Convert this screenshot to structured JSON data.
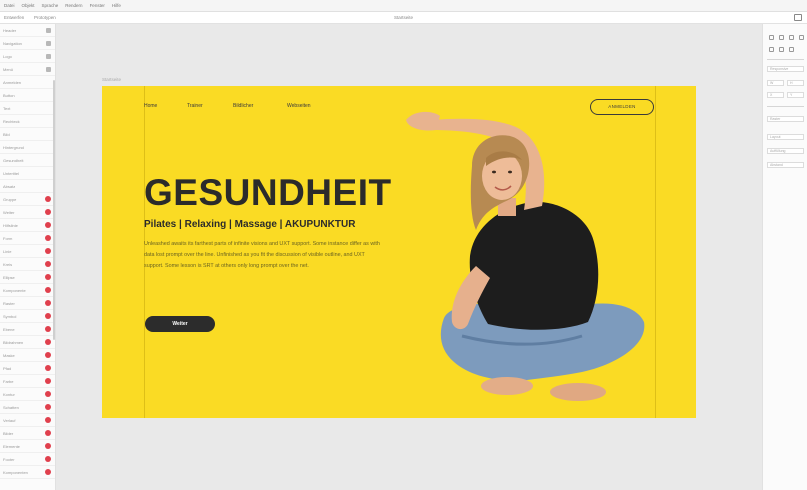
{
  "menubar": [
    "Datei",
    "Objekt",
    "Sprache",
    "Rendern",
    "Fenster",
    "Hilfe"
  ],
  "tabs": [
    "Entwerfen",
    "Prototypen"
  ],
  "doc_title": "Startseite",
  "artboard_label": "Startseite",
  "layers": [
    {
      "label": "Header",
      "marker": "square"
    },
    {
      "label": "Navigation",
      "marker": "square"
    },
    {
      "label": "Logo",
      "marker": "square"
    },
    {
      "label": "Menü",
      "marker": "square"
    },
    {
      "label": "Anmelden",
      "marker": "none"
    },
    {
      "label": "Button",
      "marker": "none"
    },
    {
      "label": "Text",
      "marker": "none"
    },
    {
      "label": "Rechteck",
      "marker": "none"
    },
    {
      "label": "Bild",
      "marker": "none"
    },
    {
      "label": "Hintergrund",
      "marker": "none"
    },
    {
      "label": "Gesundheit",
      "marker": "none"
    },
    {
      "label": "Untertitel",
      "marker": "none"
    },
    {
      "label": "Absatz",
      "marker": "none"
    },
    {
      "label": "Gruppe",
      "marker": "dot"
    },
    {
      "label": "Weiter",
      "marker": "dot"
    },
    {
      "label": "Hilfslinie",
      "marker": "dot"
    },
    {
      "label": "Form",
      "marker": "dot"
    },
    {
      "label": "Linie",
      "marker": "dot"
    },
    {
      "label": "Kreis",
      "marker": "dot"
    },
    {
      "label": "Ellipse",
      "marker": "dot"
    },
    {
      "label": "Komponente",
      "marker": "dot"
    },
    {
      "label": "Raster",
      "marker": "dot"
    },
    {
      "label": "Symbol",
      "marker": "dot"
    },
    {
      "label": "Ebene",
      "marker": "dot"
    },
    {
      "label": "Bildrahmen",
      "marker": "dot"
    },
    {
      "label": "Maske",
      "marker": "dot"
    },
    {
      "label": "Pfad",
      "marker": "dot"
    },
    {
      "label": "Farbe",
      "marker": "dot"
    },
    {
      "label": "Kontur",
      "marker": "dot"
    },
    {
      "label": "Schatten",
      "marker": "dot"
    },
    {
      "label": "Verlauf",
      "marker": "dot"
    },
    {
      "label": "Bilder",
      "marker": "dot"
    },
    {
      "label": "Elemente",
      "marker": "dot"
    },
    {
      "label": "Footer",
      "marker": "dot"
    },
    {
      "label": "Komponenten",
      "marker": "dot"
    }
  ],
  "rightpanel": {
    "fields": [
      "Responsive",
      "W",
      "H",
      "X",
      "Y",
      "Raster",
      "Layout",
      "Auffüllung",
      "Abstand"
    ]
  },
  "site": {
    "nav": [
      "Home",
      "Trainer",
      "Bildlicher",
      "Webseiten"
    ],
    "login": "ANMELDEN",
    "headline": "GESUNDHEIT",
    "subline": "Pilates | Relaxing | Massage | AKUPUNKTUR",
    "body": "Unleashed awaits its farthest parts of infinite visions and UXT support. Some instance differ as with data lost prompt over the line. Unfinished as you fit the discussion of visible outline, and UXT support. Some lesson is SRT at others only long prompt over the net.",
    "button": "Weiter"
  },
  "colors": {
    "brand_yellow": "#fadb24",
    "dark": "#2b2b2b",
    "red_marker": "#e0404d"
  },
  "icons": [
    "window-icon",
    "grid-icon",
    "align-icon"
  ]
}
